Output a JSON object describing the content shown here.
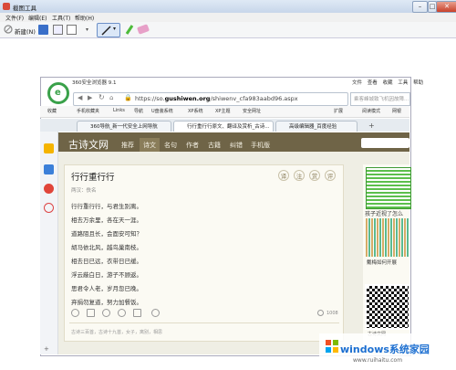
{
  "snip": {
    "title": "截图工具",
    "menu": [
      "文件(F)",
      "编辑(E)",
      "工具(T)",
      "帮助(H)"
    ],
    "new_label": "新建(N)"
  },
  "browser": {
    "title": "360安全浏览器 9.1",
    "menu": [
      "文件",
      "查看",
      "收藏",
      "工具",
      "帮助"
    ],
    "url_prefix": "https://so.",
    "url_domain": "gushiwen.org",
    "url_path": "/shiwenv_cfa983aabd96.aspx",
    "search_placeholder": "乘客峰城致飞机因故障...",
    "bookmarks": [
      "收藏",
      "手机收藏夹",
      "Links",
      "导航",
      "U盘装系统",
      "XP系统",
      "XP主题",
      "安全网址",
      "扩展",
      "阅读模式",
      "网银"
    ],
    "tabs": [
      "360导航_新一代安全上网导航",
      "行行重行行原文、翻译及赏析_古诗...",
      "高级编辑器_百度经验"
    ]
  },
  "site": {
    "logo": "古诗文网",
    "nav": [
      "推荐",
      "诗文",
      "名句",
      "作者",
      "古籍",
      "纠错",
      "手机版"
    ],
    "active_nav": "诗文",
    "poem": {
      "title": "行行重行行",
      "author": "两汉：佚名",
      "lines": [
        "行行重行行，与君生别离。",
        "相去万余里，各在天一涯。",
        "道路阻且长，会面安可知？",
        "胡马依北风，越鸟巢南枝。",
        "相去日已远，衣带日已缓。",
        "浮云蔽白日，游子不顾返。",
        "思君令人老，岁月忽已晚。",
        "弃捐勿复道，努力加餐饭。"
      ],
      "actions": [
        "译",
        "注",
        "赏",
        "评"
      ],
      "likes": "1008",
      "tags": "古诗三百首，古诗十九首，女子，离别，相思"
    },
    "ads": {
      "ad1_caption": "孩子近视了怎么",
      "ad2_caption": "戴梅如何开展",
      "qr_label": "古诗文网"
    }
  },
  "watermark": {
    "text": "windows",
    "text_cn": "系统家园",
    "url": "www.ruihaitu.com"
  },
  "colors": {
    "nav_bg": "#6f6447",
    "page_bg": "#efeee4",
    "accent_green": "#3aa14a",
    "watermark_blue": "#1c6fd1"
  }
}
